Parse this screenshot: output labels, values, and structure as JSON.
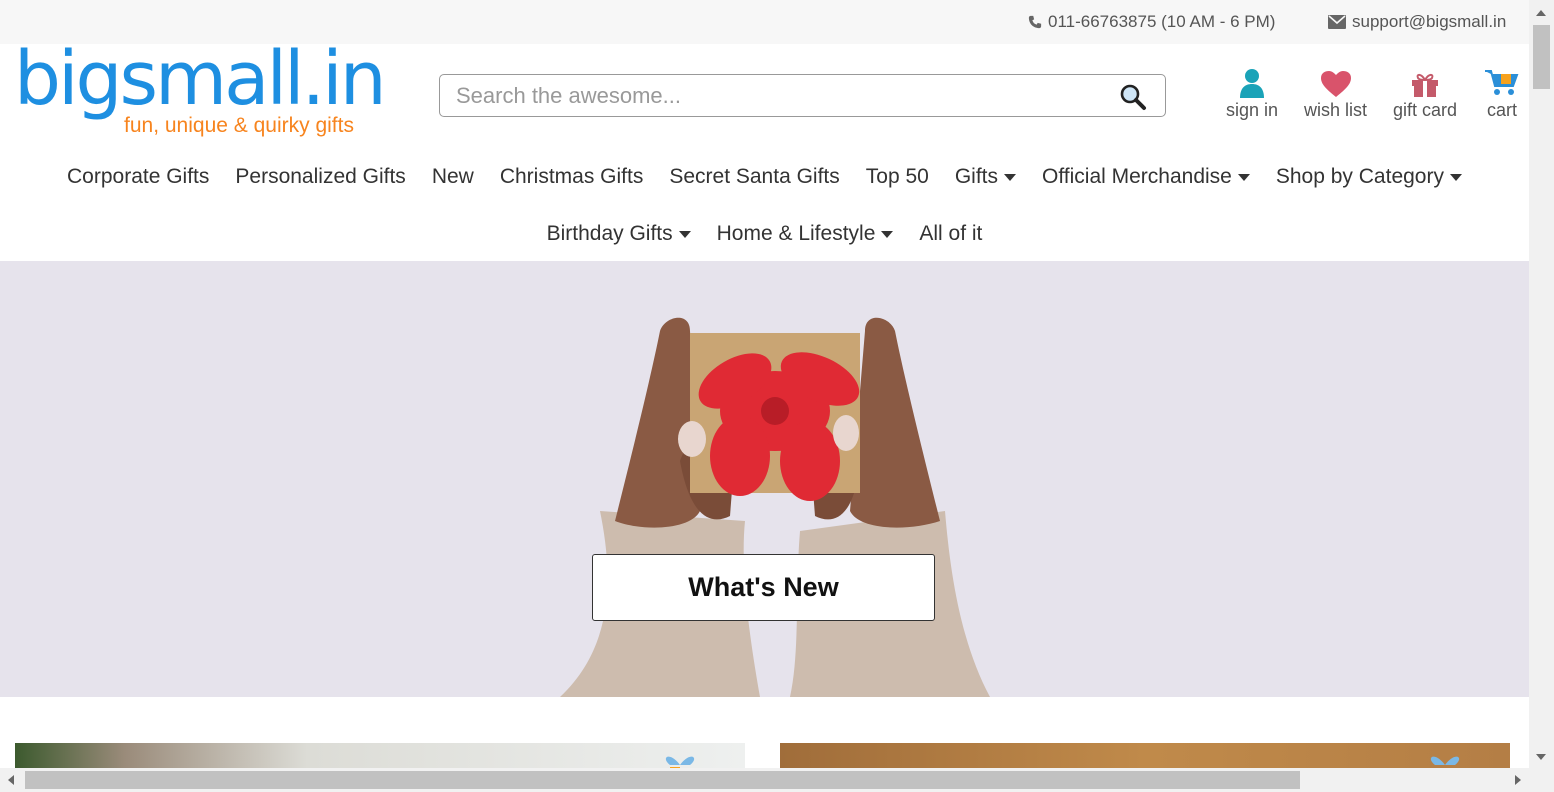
{
  "topbar": {
    "phone": "011-66763875 (10 AM - 6 PM)",
    "email": "support@bigsmall.in"
  },
  "logo": {
    "brand": "bigsmall.in",
    "tagline": "fun, unique & quirky gifts"
  },
  "search": {
    "placeholder": "Search the awesome..."
  },
  "header_links": {
    "sign_in": "sign in",
    "wish_list": "wish list",
    "gift_card": "gift card",
    "cart": "cart"
  },
  "nav_row1": [
    {
      "label": "Corporate Gifts",
      "dropdown": false
    },
    {
      "label": "Personalized Gifts",
      "dropdown": false
    },
    {
      "label": "New",
      "dropdown": false
    },
    {
      "label": "Christmas Gifts",
      "dropdown": false
    },
    {
      "label": "Secret Santa Gifts",
      "dropdown": false
    },
    {
      "label": "Top 50",
      "dropdown": false
    },
    {
      "label": "Gifts",
      "dropdown": true
    },
    {
      "label": "Official Merchandise",
      "dropdown": true
    },
    {
      "label": "Shop by Category",
      "dropdown": true
    }
  ],
  "nav_row2": [
    {
      "label": "Birthday Gifts",
      "dropdown": true
    },
    {
      "label": "Home & Lifestyle",
      "dropdown": true
    },
    {
      "label": "All of it",
      "dropdown": false
    }
  ],
  "hero": {
    "button_label": "What's New"
  },
  "colors": {
    "brand_blue": "#1e8fe1",
    "brand_orange": "#f7841e",
    "user_teal": "#1aa3b8",
    "wishlist_pink": "#d9536b",
    "giftcard_red": "#c45a6a"
  }
}
